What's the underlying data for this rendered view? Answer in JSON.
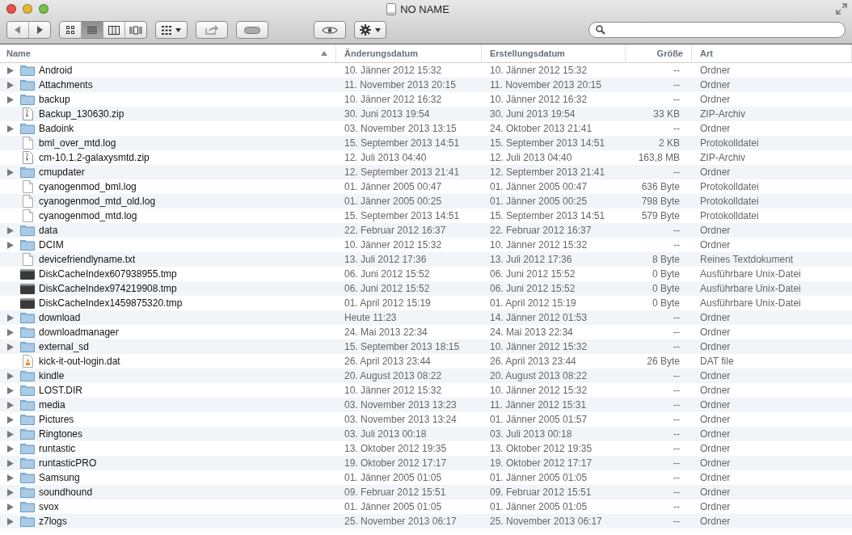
{
  "window": {
    "title": "NO NAME"
  },
  "toolbar": {
    "view_modes": [
      {
        "selected": false
      },
      {
        "selected": true
      },
      {
        "selected": false
      },
      {
        "selected": false
      }
    ]
  },
  "table": {
    "columns": [
      {
        "label": "Name",
        "sorted": true
      },
      {
        "label": "Änderungsdatum",
        "sorted": false
      },
      {
        "label": "Erstellungsdatum",
        "sorted": false
      },
      {
        "label": "Größe",
        "sorted": false
      },
      {
        "label": "Art",
        "sorted": false
      }
    ],
    "rows": [
      {
        "kind": "folder",
        "expanded": false,
        "name": "Android",
        "modified": "10. Jänner 2012 15:32",
        "created": "10. Jänner 2012 15:32",
        "size": "--",
        "type": "Ordner"
      },
      {
        "kind": "folder",
        "expanded": false,
        "name": "Attachments",
        "modified": "11. November 2013 20:15",
        "created": "11. November 2013 20:15",
        "size": "--",
        "type": "Ordner"
      },
      {
        "kind": "folder",
        "expanded": false,
        "name": "backup",
        "modified": "10. Jänner 2012 16:32",
        "created": "10. Jänner 2012 16:32",
        "size": "--",
        "type": "Ordner"
      },
      {
        "kind": "zip",
        "name": "Backup_130630.zip",
        "modified": "30. Juni 2013 19:54",
        "created": "30. Juni 2013 19:54",
        "size": "33 KB",
        "type": "ZIP-Archiv"
      },
      {
        "kind": "folder",
        "expanded": false,
        "name": "Badoink",
        "modified": "03. November 2013 13:15",
        "created": "24. Oktober 2013 21:41",
        "size": "--",
        "type": "Ordner"
      },
      {
        "kind": "doc",
        "name": "bml_over_mtd.log",
        "modified": "15. September 2013 14:51",
        "created": "15. September 2013 14:51",
        "size": "2 KB",
        "type": "Protokolldatei"
      },
      {
        "kind": "zip",
        "name": "cm-10.1.2-galaxysmtd.zip",
        "modified": "12. Juli 2013 04:40",
        "created": "12. Juli 2013 04:40",
        "size": "163,8 MB",
        "type": "ZIP-Archiv"
      },
      {
        "kind": "folder",
        "expanded": false,
        "name": "cmupdater",
        "modified": "12. September 2013 21:41",
        "created": "12. September 2013 21:41",
        "size": "--",
        "type": "Ordner"
      },
      {
        "kind": "doc",
        "name": "cyanogenmod_bml.log",
        "modified": "01. Jänner 2005 00:47",
        "created": "01. Jänner 2005 00:47",
        "size": "636 Byte",
        "type": "Protokolldatei"
      },
      {
        "kind": "doc",
        "name": "cyanogenmod_mtd_old.log",
        "modified": "01. Jänner 2005 00:25",
        "created": "01. Jänner 2005 00:25",
        "size": "798 Byte",
        "type": "Protokolldatei"
      },
      {
        "kind": "doc",
        "name": "cyanogenmod_mtd.log",
        "modified": "15. September 2013 14:51",
        "created": "15. September 2013 14:51",
        "size": "579 Byte",
        "type": "Protokolldatei"
      },
      {
        "kind": "folder",
        "expanded": false,
        "name": "data",
        "modified": "22. Februar 2012 16:37",
        "created": "22. Februar 2012 16:37",
        "size": "--",
        "type": "Ordner"
      },
      {
        "kind": "folder",
        "expanded": false,
        "name": "DCIM",
        "modified": "10. Jänner 2012 15:32",
        "created": "10. Jänner 2012 15:32",
        "size": "--",
        "type": "Ordner"
      },
      {
        "kind": "doc",
        "name": "devicefriendlyname.txt",
        "modified": "13. Juli 2012 17:36",
        "created": "13. Juli 2012 17:36",
        "size": "8 Byte",
        "type": "Reines Textdokument"
      },
      {
        "kind": "exec",
        "name": "DiskCacheIndex607938955.tmp",
        "modified": "06. Juni 2012 15:52",
        "created": "06. Juni 2012 15:52",
        "size": "0 Byte",
        "type": "Ausführbare Unix-Datei"
      },
      {
        "kind": "exec",
        "name": "DiskCacheIndex974219908.tmp",
        "modified": "06. Juni 2012 15:52",
        "created": "06. Juni 2012 15:52",
        "size": "0 Byte",
        "type": "Ausführbare Unix-Datei"
      },
      {
        "kind": "exec",
        "name": "DiskCacheIndex1459875320.tmp",
        "modified": "01. April 2012 15:19",
        "created": "01. April 2012 15:19",
        "size": "0 Byte",
        "type": "Ausführbare Unix-Datei"
      },
      {
        "kind": "folder",
        "expanded": false,
        "name": "download",
        "modified": "Heute 11:23",
        "created": "14. Jänner 2012 01:53",
        "size": "--",
        "type": "Ordner"
      },
      {
        "kind": "folder",
        "expanded": false,
        "name": "downloadmanager",
        "modified": "24. Mai 2013 22:34",
        "created": "24. Mai 2013 22:34",
        "size": "--",
        "type": "Ordner"
      },
      {
        "kind": "folder",
        "expanded": false,
        "name": "external_sd",
        "modified": "15. September 2013 18:15",
        "created": "10. Jänner 2012 15:32",
        "size": "--",
        "type": "Ordner"
      },
      {
        "kind": "media",
        "name": "kick-it-out-login.dat",
        "modified": "26. April 2013 23:44",
        "created": "26. April 2013 23:44",
        "size": "26 Byte",
        "type": "DAT file"
      },
      {
        "kind": "folder",
        "expanded": false,
        "name": "kindle",
        "modified": "20. August 2013 08:22",
        "created": "20. August 2013 08:22",
        "size": "--",
        "type": "Ordner"
      },
      {
        "kind": "folder",
        "expanded": false,
        "name": "LOST.DIR",
        "modified": "10. Jänner 2012 15:32",
        "created": "10. Jänner 2012 15:32",
        "size": "--",
        "type": "Ordner"
      },
      {
        "kind": "folder",
        "expanded": false,
        "name": "media",
        "modified": "03. November 2013 13:23",
        "created": "11. Jänner 2012 15:31",
        "size": "--",
        "type": "Ordner"
      },
      {
        "kind": "folder",
        "expanded": false,
        "name": "Pictures",
        "modified": "03. November 2013 13:24",
        "created": "01. Jänner 2005 01:57",
        "size": "--",
        "type": "Ordner"
      },
      {
        "kind": "folder",
        "expanded": false,
        "name": "Ringtones",
        "modified": "03. Juli 2013 00:18",
        "created": "03. Juli 2013 00:18",
        "size": "--",
        "type": "Ordner"
      },
      {
        "kind": "folder",
        "expanded": false,
        "name": "runtastic",
        "modified": "13. Oktober 2012 19:35",
        "created": "13. Oktober 2012 19:35",
        "size": "--",
        "type": "Ordner"
      },
      {
        "kind": "folder",
        "expanded": false,
        "name": "runtasticPRO",
        "modified": "19. Oktober 2012 17:17",
        "created": "19. Oktober 2012 17:17",
        "size": "--",
        "type": "Ordner"
      },
      {
        "kind": "folder",
        "expanded": false,
        "name": "Samsung",
        "modified": "01. Jänner 2005 01:05",
        "created": "01. Jänner 2005 01:05",
        "size": "--",
        "type": "Ordner"
      },
      {
        "kind": "folder",
        "expanded": false,
        "name": "soundhound",
        "modified": "09. Februar 2012 15:51",
        "created": "09. Februar 2012 15:51",
        "size": "--",
        "type": "Ordner"
      },
      {
        "kind": "folder",
        "expanded": false,
        "name": "svox",
        "modified": "01. Jänner 2005 01:05",
        "created": "01. Jänner 2005 01:05",
        "size": "--",
        "type": "Ordner"
      },
      {
        "kind": "folder",
        "expanded": false,
        "name": "z7logs",
        "modified": "25. November 2013 06:17",
        "created": "25. November 2013 06:17",
        "size": "--",
        "type": "Ordner"
      }
    ]
  }
}
